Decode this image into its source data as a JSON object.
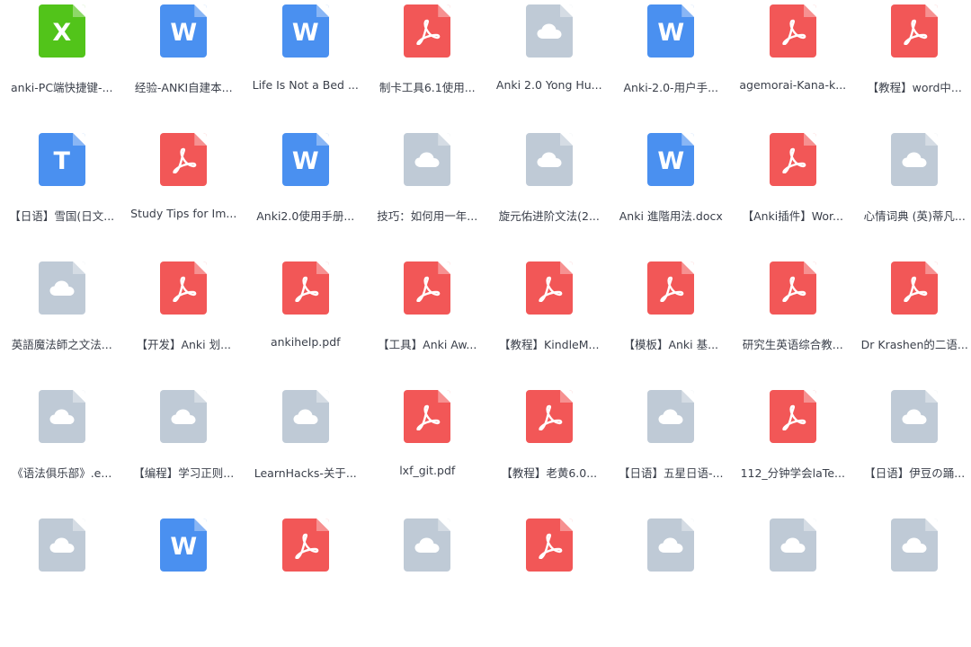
{
  "colors": {
    "excel": "#52c41a",
    "word": "#4a90f0",
    "pdf": "#f25757",
    "text": "#4a90f0",
    "cloud": "#bfcad6"
  },
  "files": [
    {
      "type": "excel",
      "icon": "excel-file-icon",
      "letter": "X",
      "name": "anki-PC端快捷键-..."
    },
    {
      "type": "word",
      "icon": "word-file-icon",
      "letter": "W",
      "name": "经验-ANKI自建本..."
    },
    {
      "type": "word",
      "icon": "word-file-icon",
      "letter": "W",
      "name": "Life Is Not a Bed ..."
    },
    {
      "type": "pdf",
      "icon": "pdf-file-icon",
      "letter": "",
      "name": "制卡工具6.1使用..."
    },
    {
      "type": "cloud",
      "icon": "cloud-file-icon",
      "letter": "",
      "name": "Anki 2.0 Yong Hu..."
    },
    {
      "type": "word",
      "icon": "word-file-icon",
      "letter": "W",
      "name": "Anki-2.0-用户手..."
    },
    {
      "type": "pdf",
      "icon": "pdf-file-icon",
      "letter": "",
      "name": "agemorai-Kana-k..."
    },
    {
      "type": "pdf",
      "icon": "pdf-file-icon",
      "letter": "",
      "name": "【教程】word中..."
    },
    {
      "type": "text",
      "icon": "text-file-icon",
      "letter": "T",
      "name": "【日语】雪国(日文..."
    },
    {
      "type": "pdf",
      "icon": "pdf-file-icon",
      "letter": "",
      "name": "Study Tips for Im..."
    },
    {
      "type": "word",
      "icon": "word-file-icon",
      "letter": "W",
      "name": "Anki2.0使用手册..."
    },
    {
      "type": "cloud",
      "icon": "cloud-file-icon",
      "letter": "",
      "name": "技巧：如何用一年..."
    },
    {
      "type": "cloud",
      "icon": "cloud-file-icon",
      "letter": "",
      "name": "旋元佑进阶文法(2..."
    },
    {
      "type": "word",
      "icon": "word-file-icon",
      "letter": "W",
      "name": "Anki 進階用法.docx"
    },
    {
      "type": "pdf",
      "icon": "pdf-file-icon",
      "letter": "",
      "name": "【Anki插件】Wor..."
    },
    {
      "type": "cloud",
      "icon": "cloud-file-icon",
      "letter": "",
      "name": "心情词典 (英)蒂凡..."
    },
    {
      "type": "cloud",
      "icon": "cloud-file-icon",
      "letter": "",
      "name": "英語魔法師之文法..."
    },
    {
      "type": "pdf",
      "icon": "pdf-file-icon",
      "letter": "",
      "name": "【开发】Anki 划..."
    },
    {
      "type": "pdf",
      "icon": "pdf-file-icon",
      "letter": "",
      "name": "ankihelp.pdf"
    },
    {
      "type": "pdf",
      "icon": "pdf-file-icon",
      "letter": "",
      "name": "【工具】Anki Aw..."
    },
    {
      "type": "pdf",
      "icon": "pdf-file-icon",
      "letter": "",
      "name": "【教程】KindleM..."
    },
    {
      "type": "pdf",
      "icon": "pdf-file-icon",
      "letter": "",
      "name": "【模板】Anki 基..."
    },
    {
      "type": "pdf",
      "icon": "pdf-file-icon",
      "letter": "",
      "name": "研究生英语综合教..."
    },
    {
      "type": "pdf",
      "icon": "pdf-file-icon",
      "letter": "",
      "name": "Dr Krashen的二语..."
    },
    {
      "type": "cloud",
      "icon": "cloud-file-icon",
      "letter": "",
      "name": "《语法俱乐部》.e..."
    },
    {
      "type": "cloud",
      "icon": "cloud-file-icon",
      "letter": "",
      "name": "【编程】学习正则..."
    },
    {
      "type": "cloud",
      "icon": "cloud-file-icon",
      "letter": "",
      "name": "LearnHacks-关于..."
    },
    {
      "type": "pdf",
      "icon": "pdf-file-icon",
      "letter": "",
      "name": "lxf_git.pdf"
    },
    {
      "type": "pdf",
      "icon": "pdf-file-icon",
      "letter": "",
      "name": "【教程】老黄6.0..."
    },
    {
      "type": "cloud",
      "icon": "cloud-file-icon",
      "letter": "",
      "name": "【日语】五星日语-..."
    },
    {
      "type": "pdf",
      "icon": "pdf-file-icon",
      "letter": "",
      "name": "112_分钟学会laTe..."
    },
    {
      "type": "cloud",
      "icon": "cloud-file-icon",
      "letter": "",
      "name": "【日语】伊豆の踊..."
    },
    {
      "type": "cloud",
      "icon": "cloud-file-icon",
      "letter": "",
      "name": ""
    },
    {
      "type": "word",
      "icon": "word-file-icon",
      "letter": "W",
      "name": ""
    },
    {
      "type": "pdf",
      "icon": "pdf-file-icon",
      "letter": "",
      "name": ""
    },
    {
      "type": "cloud",
      "icon": "cloud-file-icon",
      "letter": "",
      "name": ""
    },
    {
      "type": "pdf",
      "icon": "pdf-file-icon",
      "letter": "",
      "name": ""
    },
    {
      "type": "cloud",
      "icon": "cloud-file-icon",
      "letter": "",
      "name": ""
    },
    {
      "type": "cloud",
      "icon": "cloud-file-icon",
      "letter": "",
      "name": ""
    },
    {
      "type": "cloud",
      "icon": "cloud-file-icon",
      "letter": "",
      "name": ""
    }
  ]
}
